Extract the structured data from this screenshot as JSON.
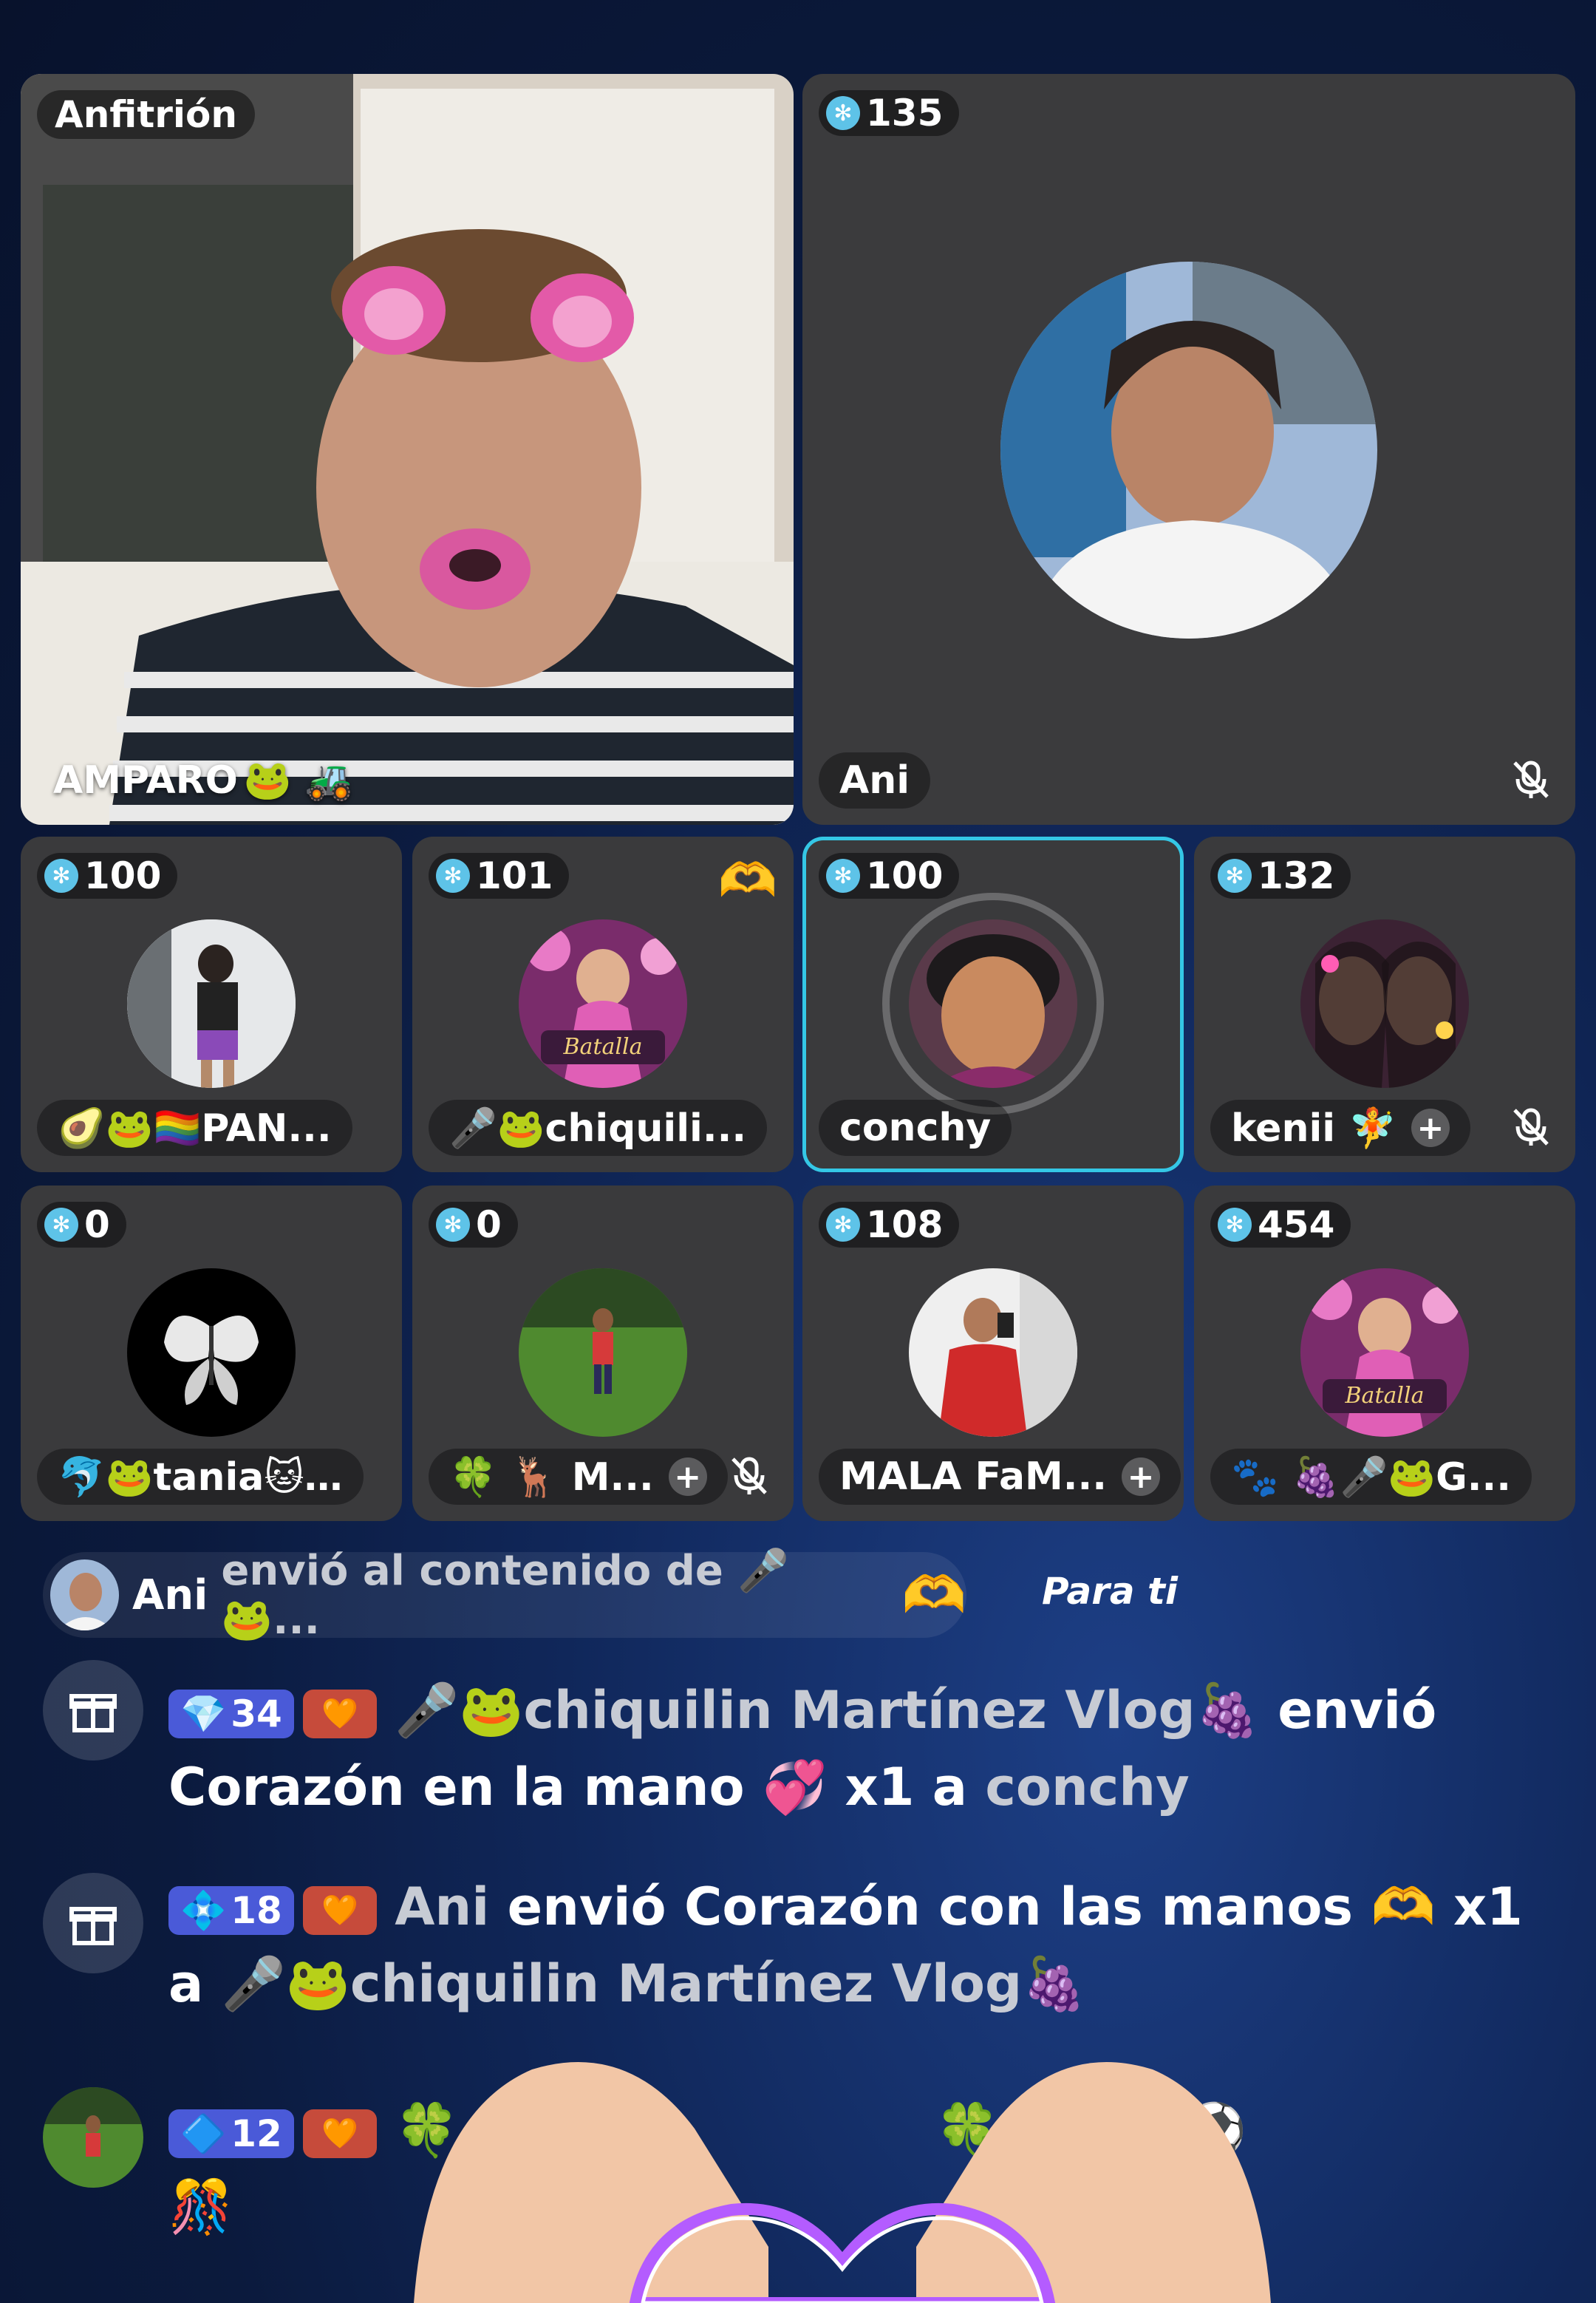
{
  "host_tile": {
    "label": "Anfitrión",
    "name": "AMPARO",
    "name_emoji": "🐸 🚜"
  },
  "guest_big": {
    "diamonds": "135",
    "name": "Ani"
  },
  "row1": [
    {
      "diamonds": "100",
      "name": "🥑🐸🏳️‍🌈PAN...",
      "muted": false
    },
    {
      "diamonds": "101",
      "name": "🎤🐸chiquili...",
      "muted": false,
      "gift_emoji": "🫶"
    },
    {
      "diamonds": "100",
      "name": "conchy",
      "muted": false,
      "speaking": true
    },
    {
      "diamonds": "132",
      "name": "kenii 🧚",
      "muted": true
    }
  ],
  "row2": [
    {
      "diamonds": "0",
      "name": "🐬🐸tania🐱…",
      "muted": false
    },
    {
      "diamonds": "0",
      "name": "🍀 🦌 M...",
      "muted": true
    },
    {
      "diamonds": "108",
      "name": "MALA FaM...",
      "muted": false
    },
    {
      "diamonds": "454",
      "name": "🐾 🍇🎤🐸G...",
      "muted": false
    }
  ],
  "notice": {
    "sender": "Ani",
    "text": "envió al contenido de 🎤🐸...",
    "emoji": "🫶",
    "tag": "Para ti"
  },
  "chat": [
    {
      "level": "34",
      "user": "🎤🐸chiquilin Martínez Vlog🍇",
      "verb": "envió",
      "gift": "Corazón en la mano 💞 x1 a",
      "target": "conchy"
    },
    {
      "level": "18",
      "user": "Ani",
      "verb": "envió Corazón con las manos 🫶 x1 a",
      "target": "🎤🐸chiquilin Martínez Vlog🍇"
    },
    {
      "level": "12",
      "user": "🍀",
      "text": "🍀 🦶 🌳 ⚽",
      "extra": "🎊"
    }
  ],
  "colors": {
    "accent_cyan": "#34c7e6",
    "tile": "#3a3a3c",
    "level_badge": "#4a5ad8",
    "heart_badge": "#c64b3b"
  }
}
